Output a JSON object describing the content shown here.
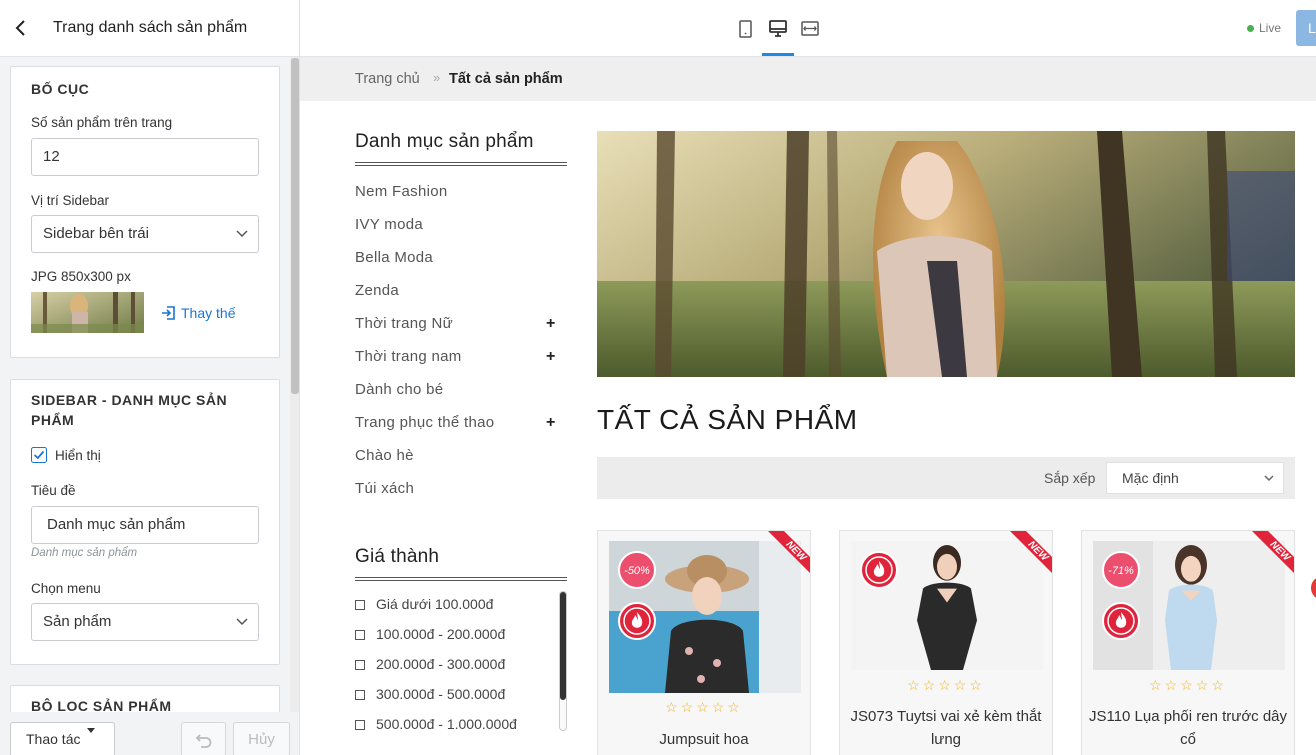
{
  "editor": {
    "back_icon": "chevron-left-icon",
    "title": "Trang danh sách sản phẩm",
    "layout": {
      "title": "BỐ CỤC",
      "per_page_label": "Số sản phẩm trên trang",
      "per_page_value": "12",
      "sidebar_position_label": "Vị trí Sidebar",
      "sidebar_position_value": "Sidebar bên trái",
      "image_label": "JPG 850x300 px",
      "replace_label": "Thay thế"
    },
    "sidebar_category": {
      "title_line1": "SIDEBAR - DANH MỤC SẢN",
      "title_line2": "PHẨM",
      "show_label": "Hiển thị",
      "show_checked": true,
      "heading_label": "Tiêu đề",
      "heading_value": "Danh mục sản phẩm",
      "heading_hint": "Danh mục sản phẩm",
      "menu_label": "Chọn menu",
      "menu_value": "Sản phẩm"
    },
    "filter": {
      "title": "BỘ LỌC SẢN PHẨM"
    },
    "footer": {
      "actions_label": "Thao tác",
      "cancel_label": "Hủy"
    }
  },
  "toolbar": {
    "devices": [
      {
        "name": "mobile",
        "icon": "mobile-icon",
        "active": false
      },
      {
        "name": "desktop",
        "icon": "desktop-icon",
        "active": true
      },
      {
        "name": "fullwidth",
        "icon": "fullwidth-icon",
        "active": false
      }
    ],
    "live_label": "Live",
    "publish_label": "L",
    "colors": {
      "accent": "#1e88e5",
      "live": "#4caf50"
    }
  },
  "preview": {
    "breadcrumb": {
      "home": "Trang chủ",
      "separator": "»",
      "current": "Tất cả sản phẩm"
    },
    "categories_heading": "Danh mục sản phẩm",
    "categories": [
      {
        "label": "Nem Fashion",
        "expandable": false
      },
      {
        "label": "IVY moda",
        "expandable": false
      },
      {
        "label": "Bella Moda",
        "expandable": false
      },
      {
        "label": "Zenda",
        "expandable": false
      },
      {
        "label": "Thời trang Nữ",
        "expandable": true
      },
      {
        "label": "Thời trang nam",
        "expandable": true
      },
      {
        "label": "Dành cho bé",
        "expandable": false
      },
      {
        "label": "Trang phục thể thao",
        "expandable": true
      },
      {
        "label": "Chào hè",
        "expandable": false
      },
      {
        "label": "Túi xách",
        "expandable": false
      }
    ],
    "expand_symbol": "+",
    "price_heading": "Giá thành",
    "prices": [
      "Giá dưới 100.000đ",
      "100.000đ - 200.000đ",
      "200.000đ - 300.000đ",
      "300.000đ - 500.000đ",
      "500.000đ - 1.000.000đ"
    ],
    "page_heading": "TẤT CẢ SẢN PHẨM",
    "sort_label": "Sắp xếp",
    "sort_value": "Mặc định",
    "products": [
      {
        "name": "Jumpsuit hoa",
        "discount": "-50%",
        "ribbon": "NEW",
        "stars": "☆☆☆☆☆"
      },
      {
        "name": "JS073 Tuytsi vai xẻ kèm thắt lưng",
        "discount": "",
        "ribbon": "NEW",
        "stars": "☆☆☆☆☆"
      },
      {
        "name": "JS110 Lụa phối ren trước dây cổ",
        "discount": "-71%",
        "ribbon": "NEW",
        "stars": "☆☆☆☆☆"
      }
    ]
  }
}
